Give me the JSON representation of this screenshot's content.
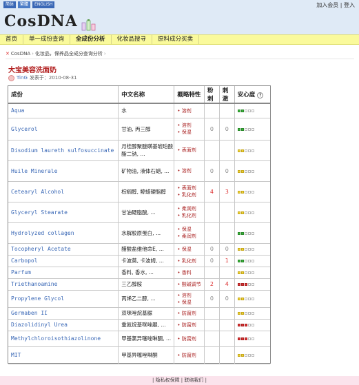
{
  "header": {
    "lang": [
      "简体",
      "繁體",
      "ENGLISH"
    ],
    "links": [
      "加入会员",
      "登入"
    ],
    "logo": "CosDNA"
  },
  "nav": [
    "首页",
    "单一成份查询",
    "全成份分析",
    "化妆品搜寻",
    "原料成分买卖"
  ],
  "breadcrumb": [
    "CosDNA",
    "化妆品，保养品全成分查询分析"
  ],
  "product": {
    "title": "大宝美容洗面奶",
    "user": "TinG",
    "date_text": "发表于：2010-08-31"
  },
  "table": {
    "headers": [
      "成份",
      "中文名称",
      "概略特性",
      "粉刺",
      "刺激",
      "安心度"
    ],
    "rows": [
      {
        "name": "Aqua",
        "cn": "水",
        "funcs": [
          "溶剂"
        ],
        "acne": "",
        "irr": "",
        "safety": "g",
        "h": 21
      },
      {
        "name": "Glycerol",
        "cn": "甘油, 丙三醇",
        "funcs": [
          "溶剂",
          "保湿"
        ],
        "acne": "0",
        "irr": "0",
        "safety": "g",
        "h": 32
      },
      {
        "name": "Disodium laureth sulfosuccinate",
        "cn": "月桂醇聚醚磺基琥珀酸酯二钠, ...",
        "funcs": [
          "表面剂"
        ],
        "acne": "",
        "irr": "",
        "safety": "y",
        "h": 30
      },
      {
        "name": "Huile Minerale",
        "cn": "矿物油, 液体石蜡, ...",
        "funcs": [
          "溶剂"
        ],
        "acne": "0",
        "irr": "0",
        "safety": "y",
        "h": 30
      },
      {
        "name": "Cetearyl Alcohol",
        "cn": "棕榈醇, 鲸蜡硬脂醇",
        "funcs": [
          "表面剂",
          "乳化剂"
        ],
        "acne": "4",
        "irr": "3",
        "safety": "y",
        "h": 30
      },
      {
        "name": "Glyceryl Stearate",
        "cn": "甘油硬脂酸, ...",
        "funcs": [
          "柔润剂",
          "乳化剂"
        ],
        "acne": "",
        "irr": "",
        "safety": "y",
        "h": 30
      },
      {
        "name": "Hydrolyzed collagen",
        "cn": "水解胶原蛋白, ...",
        "funcs": [
          "保湿",
          "柔润剂"
        ],
        "acne": "",
        "irr": "",
        "safety": "g",
        "h": 30
      },
      {
        "name": "Tocopheryl Acetate",
        "cn": "醋酸盐维他命E, ...",
        "funcs": [
          "保湿"
        ],
        "acne": "0",
        "irr": "0",
        "safety": "y",
        "h": 17
      },
      {
        "name": "Carbopol",
        "cn": "卡波莫, 卡波姆, ...",
        "funcs": [
          "乳化剂"
        ],
        "acne": "0",
        "irr": "1",
        "safety": "g",
        "h": 17
      },
      {
        "name": "Parfum",
        "cn": "香料, 香水, ...",
        "funcs": [
          "香料"
        ],
        "acne": "",
        "irr": "",
        "safety": "y",
        "h": 17
      },
      {
        "name": "Triethanoamine",
        "cn": "三乙醇胺",
        "funcs": [
          "酸碱调节"
        ],
        "acne": "2",
        "irr": "4",
        "safety": "r",
        "h": 17
      },
      {
        "name": "Propylene Glycol",
        "cn": "丙烯乙二醇, ...",
        "funcs": [
          "溶剂",
          "保湿"
        ],
        "acne": "0",
        "irr": "0",
        "safety": "y",
        "h": 25
      },
      {
        "name": "Germaben II",
        "cn": "双咪唑烷基脲",
        "funcs": [
          "防腐剂"
        ],
        "acne": "",
        "irr": "",
        "safety": "y",
        "h": 17
      },
      {
        "name": "Diazolidinyl Urea",
        "cn": "重氮烷基咪唑脲, ...",
        "funcs": [
          "防腐剂"
        ],
        "acne": "",
        "irr": "",
        "safety": "r",
        "h": 17
      },
      {
        "name": "Methylchloroisothiazolinone",
        "cn": "甲基氯异噻唑啉酮, ...",
        "funcs": [
          "防腐剂"
        ],
        "acne": "",
        "irr": "",
        "safety": "r",
        "h": 23
      },
      {
        "name": "MIT",
        "cn": "甲基异噻唑啉酮",
        "funcs": [
          "防腐剂"
        ],
        "acne": "",
        "irr": "",
        "safety": "y",
        "h": 25
      }
    ]
  },
  "footer": "| 隐私权保障 | 联络我们 |"
}
